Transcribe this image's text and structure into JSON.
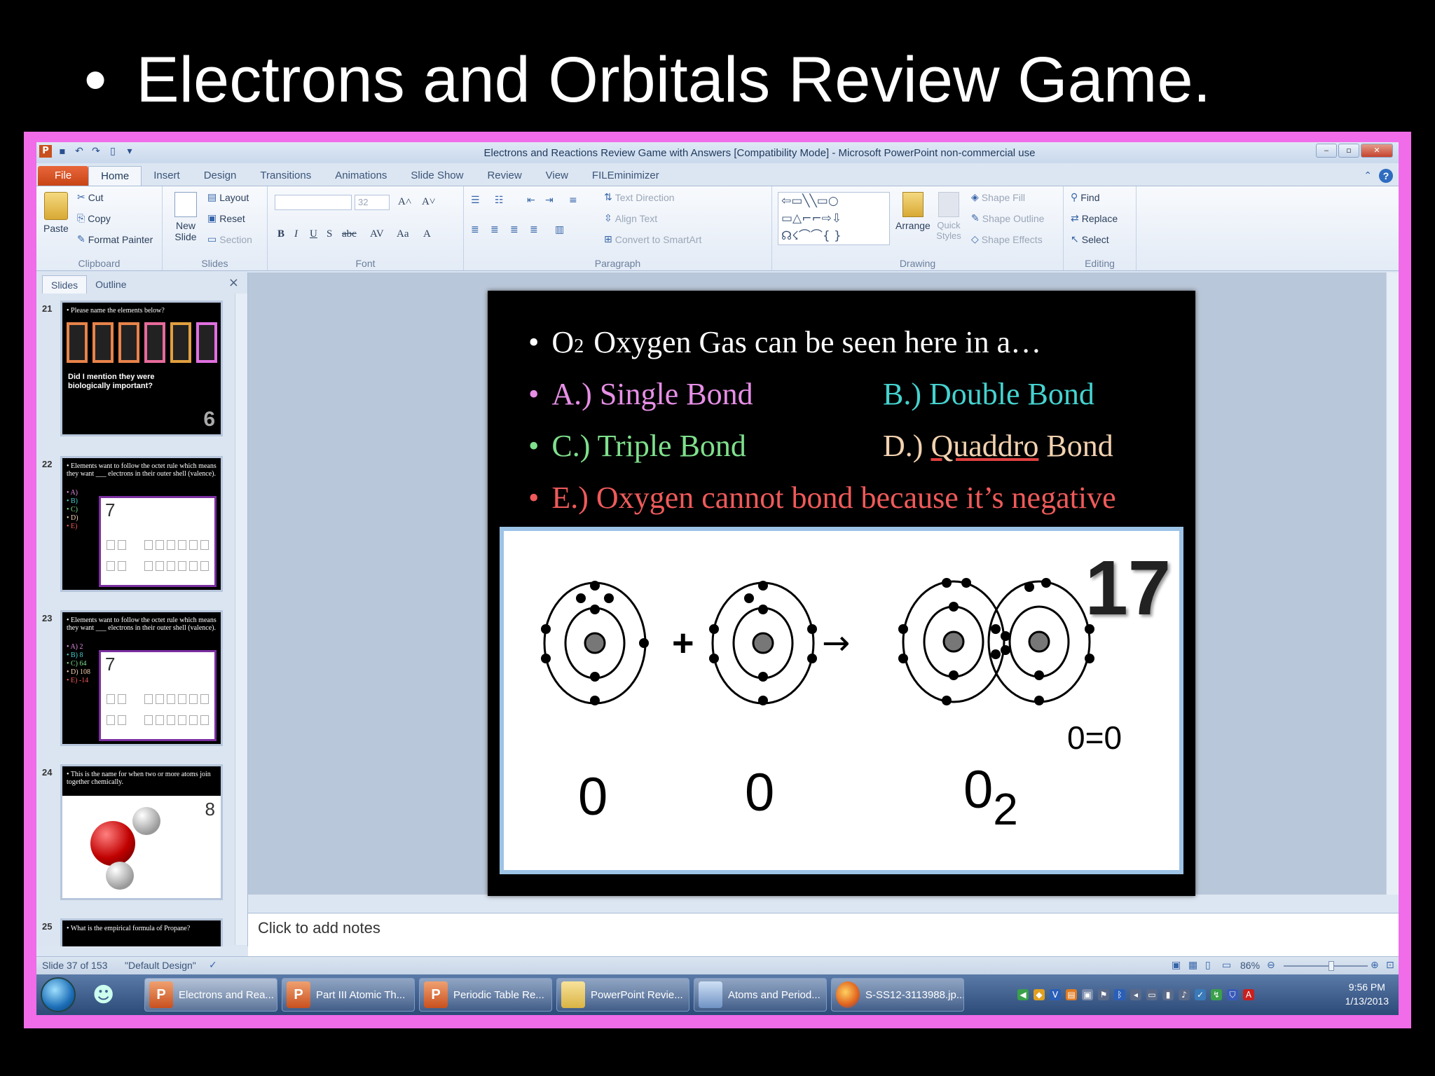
{
  "heading": {
    "bullet": "•",
    "text": "Electrons and Orbitals Review Game."
  },
  "window": {
    "title": "Electrons and Reactions Review Game with Answers [Compatibility Mode] - Microsoft PowerPoint non-commercial use",
    "app_logo": "P"
  },
  "tabs": [
    "File",
    "Home",
    "Insert",
    "Design",
    "Transitions",
    "Animations",
    "Slide Show",
    "Review",
    "View",
    "FILEminimizer"
  ],
  "ribbon": {
    "clipboard": {
      "paste": "Paste",
      "cut": "Cut",
      "copy": "Copy",
      "format_painter": "Format Painter",
      "label": "Clipboard"
    },
    "slides": {
      "new_slide": "New Slide",
      "layout": "Layout",
      "reset": "Reset",
      "section": "Section",
      "label": "Slides"
    },
    "font": {
      "size": "32",
      "label": "Font"
    },
    "paragraph": {
      "text_direction": "Text Direction",
      "align_text": "Align Text",
      "convert_smartart": "Convert to SmartArt",
      "label": "Paragraph"
    },
    "drawing": {
      "arrange": "Arrange",
      "quick_styles": "Quick Styles",
      "shape_fill": "Shape Fill",
      "shape_outline": "Shape Outline",
      "shape_effects": "Shape Effects",
      "label": "Drawing"
    },
    "editing": {
      "find": "Find",
      "replace": "Replace",
      "select": "Select",
      "label": "Editing"
    }
  },
  "pane": {
    "tabs": [
      "Slides",
      "Outline"
    ],
    "thumbs": [
      {
        "num": "21",
        "text": "• Please name the elements below?",
        "sub": "Did I mention they were biologically important?",
        "badge": "6"
      },
      {
        "num": "22",
        "text": "• Elements want to follow the octet rule which means they want ___ electrons in their outer shell (valence).",
        "opts": [
          "• A)",
          "• B)",
          "• C)",
          "• D)",
          "• E)"
        ],
        "badge": "7"
      },
      {
        "num": "23",
        "text": "• Elements want to follow the octet rule which means they want ___ electrons in their outer shell (valence).",
        "opts": [
          "• A) 2",
          "• B) 8",
          "• C) 64",
          "• D) 108",
          "• E) -14"
        ],
        "badge": "7"
      },
      {
        "num": "24",
        "text": "• This is the name for when two or more atoms join together chemically.",
        "badge": "8"
      },
      {
        "num": "25",
        "text": "• What is the empirical formula of Propane?",
        "badge": ""
      }
    ]
  },
  "slide": {
    "q_prefix": "O",
    "q_sub": "2",
    "q_text": "Oxygen Gas can be seen here in a…",
    "a": "A.) Single Bond",
    "b": "B.) Double Bond",
    "c": "C.) Triple Bond",
    "d_prefix": "D.)",
    "d_word": "Quaddro",
    "d_suffix": "Bond",
    "e": "E.) Oxygen cannot bond because it’s negative",
    "bullet": "•",
    "colors": {
      "a": "#e78fe6",
      "b": "#45d3d0",
      "c": "#7fe08d",
      "d": "#f2d2b0",
      "e": "#f05a5a"
    },
    "diagram": {
      "counter": "17",
      "bond_label": "0=0",
      "label1": "0",
      "label2": "0",
      "label3_main": "0",
      "label3_sub": "2"
    }
  },
  "notes_placeholder": "Click to add notes",
  "status": {
    "slide_info": "Slide 37 of 153",
    "theme": "\"Default Design\"",
    "zoom": "86%"
  },
  "taskbar": {
    "items": [
      "Electrons and Rea...",
      "Part III Atomic Th...",
      "Periodic Table Re...",
      "PowerPoint Revie...",
      "Atoms and Period...",
      "S-SS12-3113988.jp..."
    ],
    "time": "9:56 PM",
    "date": "1/13/2013"
  }
}
